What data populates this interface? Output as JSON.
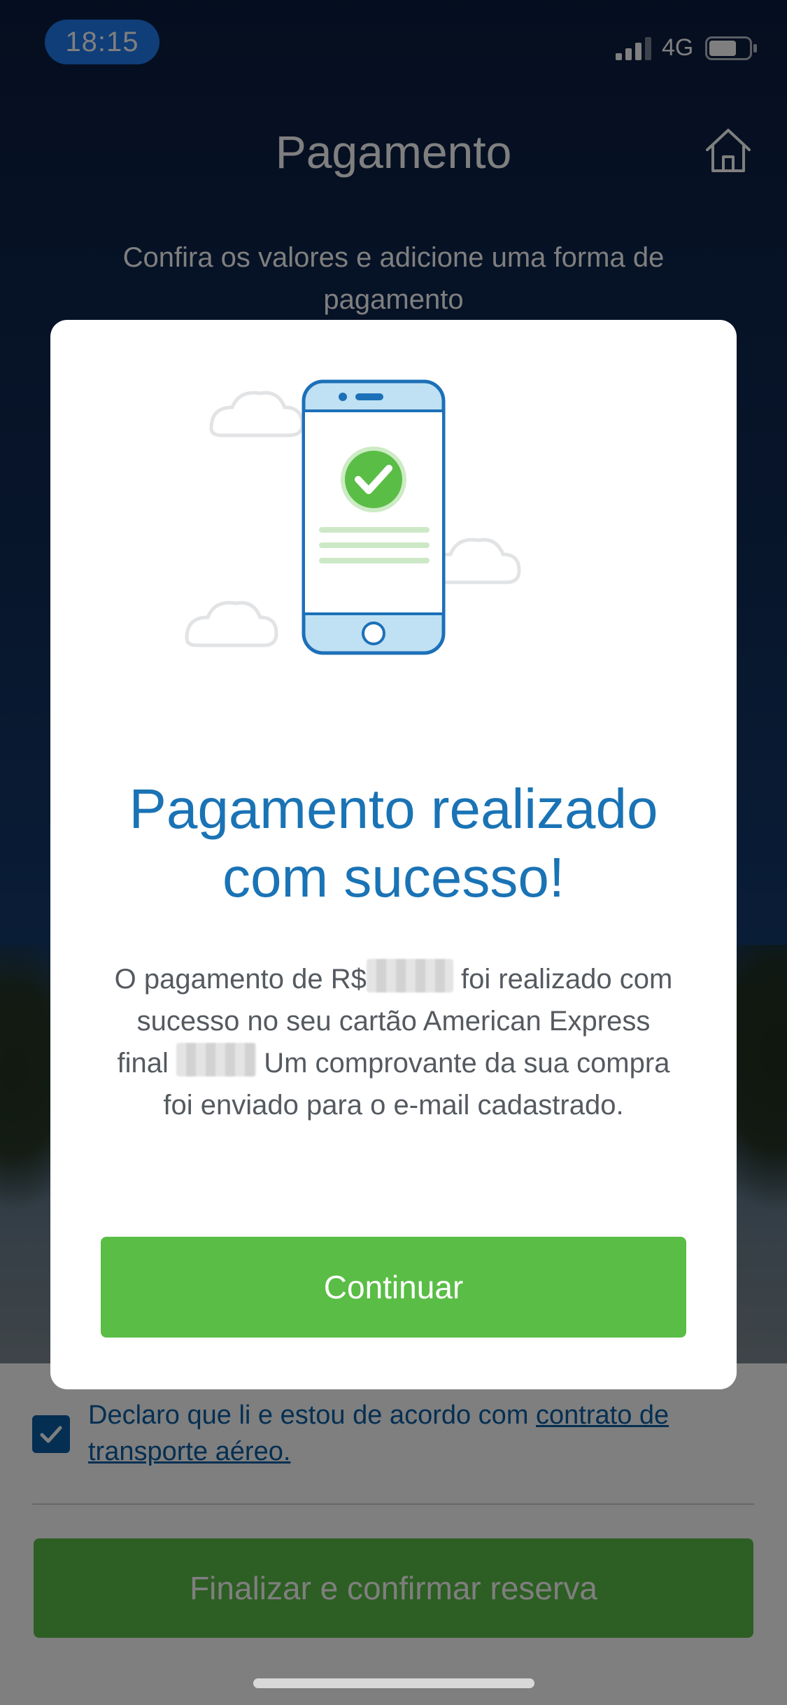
{
  "status_bar": {
    "time": "18:15",
    "network": "4G",
    "signal_icon": "signal-bars-icon",
    "battery_icon": "battery-icon"
  },
  "header": {
    "title": "Pagamento",
    "home_icon": "home-icon",
    "subtitle": "Confira os valores e adicione uma forma de pagamento"
  },
  "modal": {
    "illustration": "phone-success-icon",
    "title": "Pagamento realizado com sucesso!",
    "message_part1": "O pagamento de R$",
    "message_part2": "foi realizado com sucesso no seu cartão American Express final",
    "message_part3": "Um comprovante da sua compra foi enviado para o e-mail cadastrado.",
    "continue_label": "Continuar"
  },
  "terms": {
    "checked": true,
    "text": "Declaro que li e estou de acordo com ",
    "link_text": "contrato de transporte aéreo."
  },
  "footer": {
    "finalize_label": "Finalizar e confirmar reserva"
  },
  "colors": {
    "accent_green": "#5abd46",
    "title_blue": "#1a73b5",
    "link_blue": "#0b5fa5",
    "time_pill": "#1e7cf2"
  }
}
